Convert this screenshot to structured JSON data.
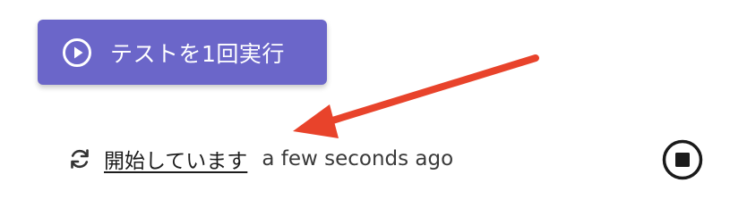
{
  "run_button": {
    "label": "テストを1回実行",
    "icon": "play-circle-icon",
    "color": "#6b66c9"
  },
  "status": {
    "icon": "sync-icon",
    "link_text": "開始しています",
    "time_text": "a few seconds ago"
  },
  "stop_button": {
    "icon": "stop-circle-icon"
  },
  "annotation": {
    "type": "arrow",
    "color": "#e8432b"
  }
}
